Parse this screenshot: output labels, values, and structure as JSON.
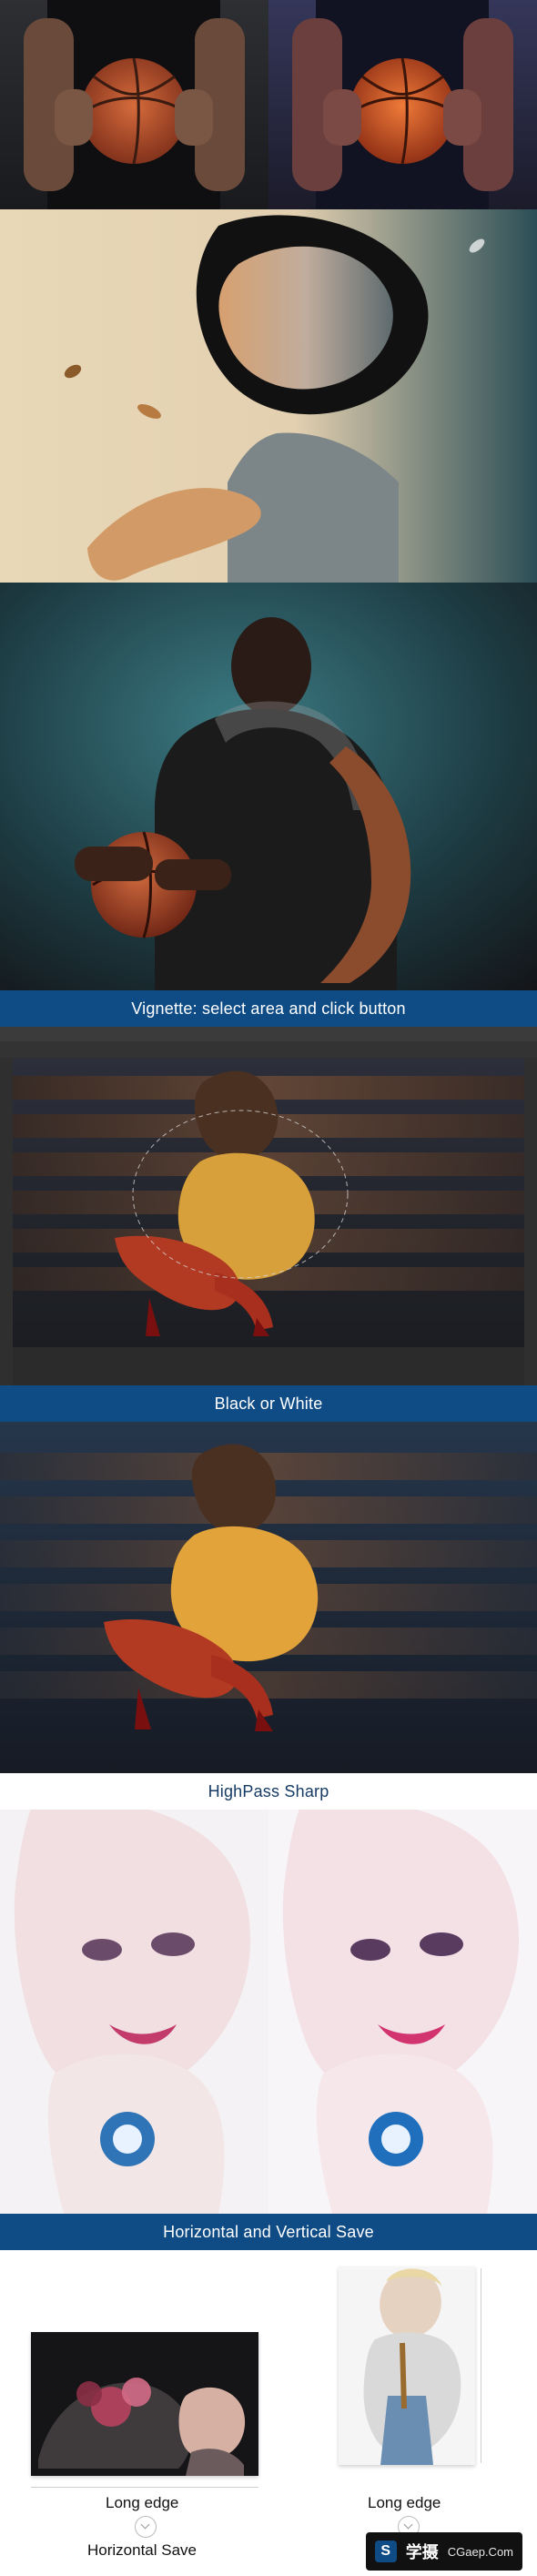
{
  "banners": {
    "vignette": "Vignette: select area and click button",
    "bw": "Black or White",
    "highpass": "HighPass Sharp",
    "save": "Horizontal and Vertical Save"
  },
  "save_section": {
    "left_caption": "Long edge",
    "right_caption": "Long edge",
    "bottom_caption": "Horizontal Save"
  },
  "watermark": {
    "brand": "学摄",
    "site": "CGaep.Com"
  }
}
